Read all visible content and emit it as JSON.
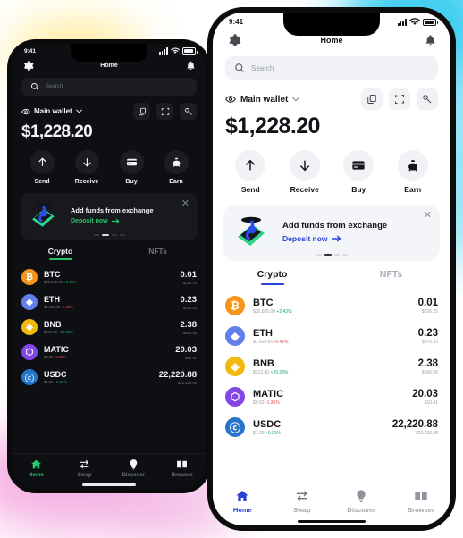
{
  "accent": {
    "light_theme": "#2b42d6",
    "dark_theme": "#27c569"
  },
  "status_bar": {
    "time": "9:41",
    "signal_icon": "cellular-signal-icon",
    "wifi_icon": "wifi-icon",
    "battery_icon": "battery-icon"
  },
  "header": {
    "title": "Home",
    "settings_icon": "gear-icon",
    "notifications_icon": "bell-icon"
  },
  "search": {
    "placeholder": "Search",
    "icon": "search-icon"
  },
  "wallet": {
    "name": "Main wallet",
    "eye_icon": "eye-icon",
    "chevron_icon": "chevron-down-icon",
    "balance": "$1,228.20",
    "actions": [
      {
        "name": "copy",
        "icon": "copy-icon"
      },
      {
        "name": "scan",
        "icon": "scan-icon"
      },
      {
        "name": "connect",
        "icon": "connect-icon"
      }
    ]
  },
  "quick_actions": [
    {
      "label": "Send",
      "icon": "arrow-up-icon"
    },
    {
      "label": "Receive",
      "icon": "arrow-down-icon"
    },
    {
      "label": "Buy",
      "icon": "credit-card-icon"
    },
    {
      "label": "Earn",
      "icon": "piggy-bank-icon"
    }
  ],
  "banner": {
    "title": "Add funds from exchange",
    "link": "Deposit now",
    "link_arrow": "arrow-right-icon",
    "close_icon": "close-icon",
    "art": "phone-with-coin-illustration",
    "dots": [
      false,
      true,
      false,
      false
    ]
  },
  "tabs": [
    {
      "label": "Crypto",
      "active": true
    },
    {
      "label": "NFTs",
      "active": false
    }
  ],
  "tokens": [
    {
      "symbol": "BTC",
      "price": "$26,685.00",
      "change": "+2.43%",
      "direction": "up",
      "amount": "0.01",
      "fiat": "$226.25",
      "color": "#f7941a",
      "glyph": "₿"
    },
    {
      "symbol": "ETH",
      "price": "$1,628.65",
      "change": "-0.42%",
      "direction": "down",
      "amount": "0.23",
      "fiat": "$375.33",
      "color": "#627eea",
      "glyph": "◆"
    },
    {
      "symbol": "BNB",
      "price": "$212.80",
      "change": "+20.28%",
      "direction": "up",
      "amount": "2.38",
      "fiat": "$506.95",
      "color": "#f0b90b",
      "glyph": "◈"
    },
    {
      "symbol": "MATIC",
      "price": "$0.52",
      "change": "-1.36%",
      "direction": "down",
      "amount": "20.03",
      "fiat": "$10.41",
      "color": "#8247e5",
      "glyph": "⬡"
    },
    {
      "symbol": "USDC",
      "price": "$1.00",
      "change": "+0.01%",
      "direction": "up",
      "amount": "22,220.88",
      "fiat": "$22,220.88",
      "color": "#2775ca",
      "glyph": "Ⓒ"
    }
  ],
  "bottom_nav": [
    {
      "label": "Home",
      "icon": "home-icon",
      "active": true
    },
    {
      "label": "Swap",
      "icon": "swap-icon",
      "active": false
    },
    {
      "label": "Discover",
      "icon": "lightbulb-icon",
      "active": false
    },
    {
      "label": "Browser",
      "icon": "book-icon",
      "active": false
    }
  ]
}
